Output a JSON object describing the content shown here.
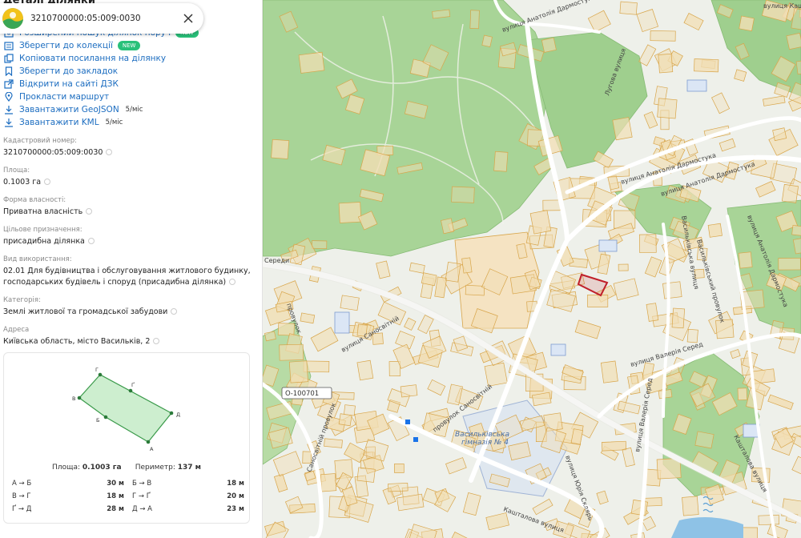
{
  "panel": {
    "title": "Деталі ділянки",
    "search_value": "3210700000:05:009:0030"
  },
  "actions": [
    {
      "label": "Розширений пошук ділянок поруч",
      "icon": "search-area-icon",
      "badge": "NEW"
    },
    {
      "label": "Зберегти до колекції",
      "icon": "collection-icon",
      "badge": "NEW"
    },
    {
      "label": "Копіювати посилання на ділянку",
      "icon": "copy-icon"
    },
    {
      "label": "Зберегти до закладок",
      "icon": "bookmark-icon"
    },
    {
      "label": "Відкрити на сайті ДЗК",
      "icon": "external-link-icon"
    },
    {
      "label": "Прокласти маршрут",
      "icon": "pin-icon"
    },
    {
      "label": "Завантажити GeoJSON",
      "icon": "download-icon",
      "rate": "5/міс"
    },
    {
      "label": "Завантажити KML",
      "icon": "download-icon",
      "rate": "5/міс"
    }
  ],
  "properties": [
    {
      "label": "Кадастровий номер:",
      "value": "3210700000:05:009:0030"
    },
    {
      "label": "Площа:",
      "value": "0.1003 га"
    },
    {
      "label": "Форма власності:",
      "value": "Приватна власність"
    },
    {
      "label": "Цільове призначення:",
      "value": "присадибна ділянка"
    },
    {
      "label": "Вид використання:",
      "value": "02.01 Для будівництва і обслуговування житлового будинку, господарських будівель і споруд (присадибна ділянка)"
    },
    {
      "label": "Категорія:",
      "value": "Землі житлової та громадської забудови"
    },
    {
      "label": "Адреса",
      "value": "Київська область, місто Васильків, 2"
    }
  ],
  "shape": {
    "area_label": "Площа:",
    "area_value": "0.1003 га",
    "perimeter_label": "Периметр:",
    "perimeter_value": "137 м",
    "vertices": [
      "А",
      "Б",
      "В",
      "Г",
      "Ґ",
      "Д"
    ],
    "sides": [
      {
        "name": "А → Б",
        "length": "30 м"
      },
      {
        "name": "Б → В",
        "length": "18 м"
      },
      {
        "name": "В → Г",
        "length": "18 м"
      },
      {
        "name": "Г → Ґ",
        "length": "20 м"
      },
      {
        "name": "Ґ → Д",
        "length": "28 м"
      },
      {
        "name": "Д → А",
        "length": "23 м"
      }
    ]
  },
  "map": {
    "streets": [
      "вулиця Анатолія Дармостука",
      "вулиця Анатолія Дармостука",
      "вулиця Анатолія Дармостука",
      "Васильківська вулиця",
      "Васильківський провулок",
      "вулиця Анатолія Дармостука",
      "вулиця Валерія Серед",
      "вулиця Валерія Серед",
      "провулок Саносвітній",
      "Кашталова вулиця",
      "вулиця Юрія Склярь",
      "Кашталова вулиця",
      "вулиця Саносвітній",
      "Саносвітній провулок",
      "провулок",
      "Середи",
      "вулиця Кашталова",
      "Лугова вулиця"
    ],
    "road_shield": "О-100701",
    "poi": "Васильківська гімназія № 4",
    "colors": {
      "forest": "#9fcf8e",
      "parcel_fill": "#f1deb4",
      "parcel_stroke": "#d8a54a",
      "selected": "#c0202a",
      "road": "#ffffff",
      "water": "#5a9fd4"
    }
  }
}
